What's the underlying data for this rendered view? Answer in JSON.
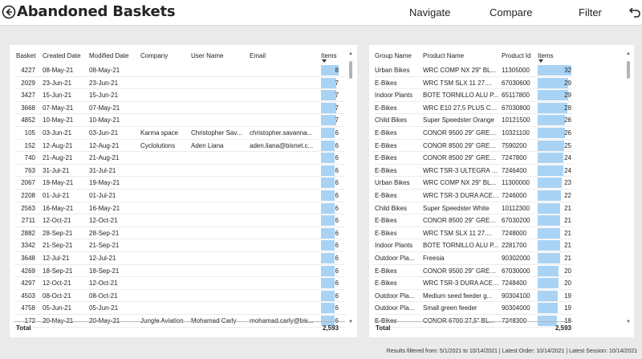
{
  "header": {
    "title": "Abandoned Baskets",
    "nav": [
      "Navigate",
      "Compare",
      "Filter"
    ]
  },
  "left_table": {
    "columns": [
      "Basket",
      "Created Date",
      "Modified Date",
      "Company",
      "User Name",
      "Email",
      "Items"
    ],
    "sorted_column": "Items",
    "rows": [
      [
        "4227",
        "08-May-21",
        "08-May-21",
        "",
        "",
        "",
        "8"
      ],
      [
        "2029",
        "23-Jun-21",
        "23-Jun-21",
        "",
        "",
        "",
        "7"
      ],
      [
        "3427",
        "15-Jun-21",
        "15-Jun-21",
        "",
        "",
        "",
        "7"
      ],
      [
        "3668",
        "07-May-21",
        "07-May-21",
        "",
        "",
        "",
        "7"
      ],
      [
        "4852",
        "10-May-21",
        "10-May-21",
        "",
        "",
        "",
        "7"
      ],
      [
        "105",
        "03-Jun-21",
        "03-Jun-21",
        "Karma space",
        "Christopher Sav...",
        "christopher.savanna...",
        "6"
      ],
      [
        "152",
        "12-Aug-21",
        "12-Aug-21",
        "Cyclolutions",
        "Aden Liana",
        "aden.liana@bisnet.c...",
        "6"
      ],
      [
        "740",
        "21-Aug-21",
        "21-Aug-21",
        "",
        "",
        "",
        "6"
      ],
      [
        "763",
        "31-Jul-21",
        "31-Jul-21",
        "",
        "",
        "",
        "6"
      ],
      [
        "2067",
        "19-May-21",
        "19-May-21",
        "",
        "",
        "",
        "6"
      ],
      [
        "2208",
        "01-Jul-21",
        "01-Jul-21",
        "",
        "",
        "",
        "6"
      ],
      [
        "2563",
        "16-May-21",
        "16-May-21",
        "",
        "",
        "",
        "6"
      ],
      [
        "2711",
        "12-Oct-21",
        "12-Oct-21",
        "",
        "",
        "",
        "6"
      ],
      [
        "2882",
        "28-Sep-21",
        "28-Sep-21",
        "",
        "",
        "",
        "6"
      ],
      [
        "3342",
        "21-Sep-21",
        "21-Sep-21",
        "",
        "",
        "",
        "6"
      ],
      [
        "3648",
        "12-Jul-21",
        "12-Jul-21",
        "",
        "",
        "",
        "6"
      ],
      [
        "4269",
        "18-Sep-21",
        "18-Sep-21",
        "",
        "",
        "",
        "6"
      ],
      [
        "4297",
        "12-Oct-21",
        "12-Oct-21",
        "",
        "",
        "",
        "6"
      ],
      [
        "4503",
        "08-Oct-21",
        "08-Oct-21",
        "",
        "",
        "",
        "6"
      ],
      [
        "4758",
        "05-Jun-21",
        "05-Jun-21",
        "",
        "",
        "",
        "6"
      ],
      [
        "172",
        "20-May-21",
        "20-May-21",
        "Jungle Aviation",
        "Mohamad Carly",
        "mohamad.carly@bis...",
        "6"
      ]
    ],
    "total_label": "Total",
    "total_value": "2,593",
    "max_items": 8
  },
  "right_table": {
    "columns": [
      "Group Name",
      "Product Name",
      "Product Id",
      "Items"
    ],
    "sorted_column": "Items",
    "rows": [
      [
        "Urban Bikes",
        "WRC COMP NX 29\" BL...",
        "11305000",
        "32"
      ],
      [
        "E-Bikes",
        "WRC TSM SLX 11 27....",
        "67030600",
        "29"
      ],
      [
        "Indoor Plants",
        "BOTE TORNILLO ALU P...",
        "65117800",
        "29"
      ],
      [
        "E-Bikes",
        "WRC E10 27,5 PLUS CA...",
        "67030800",
        "28"
      ],
      [
        "Child Bikes",
        "Super Speedster Orange",
        "10121500",
        "26"
      ],
      [
        "E-Bikes",
        "CONOR 9500 29\" GREE...",
        "10321100",
        "26"
      ],
      [
        "E-Bikes",
        "CONOR 8500 29\" GREE...",
        "7590200",
        "25"
      ],
      [
        "E-Bikes",
        "CONOR 8500 29\" GREE...",
        "7247800",
        "24"
      ],
      [
        "E-Bikes",
        "WRC TSR-3 ULTEGRA B...",
        "7246400",
        "24"
      ],
      [
        "Urban Bikes",
        "WRC COMP NX 29\" BL...",
        "11300000",
        "23"
      ],
      [
        "E-Bikes",
        "WRC TSR-3 DURA ACE ...",
        "7246000",
        "22"
      ],
      [
        "Child Bikes",
        "Super Speedster White",
        "10112300",
        "21"
      ],
      [
        "E-Bikes",
        "CONOR 8500 29\" GREE...",
        "67030200",
        "21"
      ],
      [
        "E-Bikes",
        "WRC TSM SLX 11 27....",
        "7248000",
        "21"
      ],
      [
        "Indoor Plants",
        "BOTE TORNILLO ALU P...",
        "2281700",
        "21"
      ],
      [
        "Outdoor Pla...",
        "Freesia",
        "90302000",
        "21"
      ],
      [
        "E-Bikes",
        "CONOR 9500 29\" GREE...",
        "67030000",
        "20"
      ],
      [
        "E-Bikes",
        "WRC TSR-3 DURA ACE ...",
        "7248400",
        "20"
      ],
      [
        "Outdoor Pla...",
        "Medium seed feeder g...",
        "90304100",
        "19"
      ],
      [
        "Outdoor Pla...",
        "Small green feeder",
        "90304000",
        "19"
      ],
      [
        "E-Bikes",
        "CONOR 6700 27,5\" BL...",
        "7248300",
        "18"
      ]
    ],
    "total_label": "Total",
    "total_value": "2,593",
    "max_items": 32
  },
  "footer": {
    "text": "Results filtered from: 5/1/2021 to 10/14/2021  |  Latest Order: 10/14/2021  |  Latest Session: 10/14/2021"
  },
  "colors": {
    "bar": "#a9d3f5",
    "background": "#eaeaea"
  },
  "icons": {
    "back": "back-circle-arrow-icon",
    "undo": "undo-arrow-icon"
  }
}
